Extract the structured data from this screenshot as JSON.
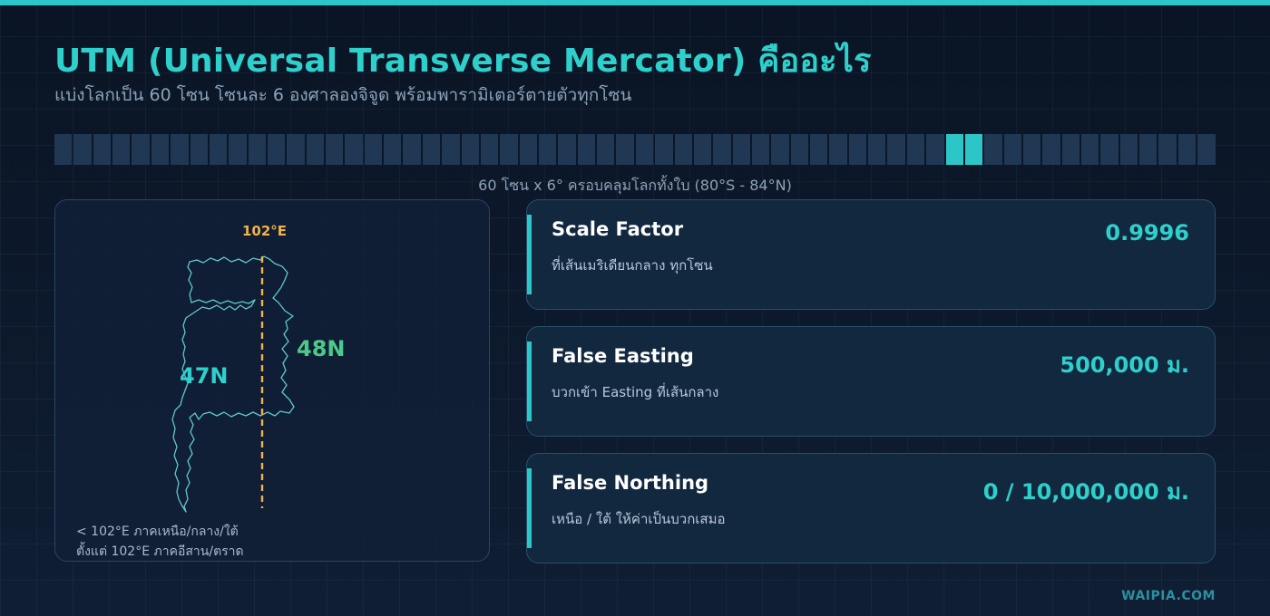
{
  "header": {
    "title": "UTM (Universal Transverse Mercator) คืออะไร",
    "subtitle": "แบ่งโลกเป็น 60 โซน โซนละ 6 องศาลองจิจูด พร้อมพารามิเตอร์ตายตัวทุกโซน"
  },
  "zone_strip": {
    "total_zones": 60,
    "highlighted_zones": [
      47,
      48
    ],
    "caption": "60 โซน x 6° ครอบคลุมโลกทั้งใบ (80°S - 84°N)",
    "colors": {
      "zone": "#203853",
      "highlight": "#2cc6c8"
    }
  },
  "map": {
    "meridian_label": "102°E",
    "zone_west": "47N",
    "zone_east": "48N",
    "legend": [
      "< 102°E ภาคเหนือ/กลาง/ใต้",
      "ตั้งแต่ 102°E ภาคอีสาน/ตราด"
    ],
    "colors": {
      "outline": "#5fc9c9",
      "meridian": "#f1b24a",
      "west": "#2ed0cc",
      "east": "#4cc98a"
    }
  },
  "cards": [
    {
      "title": "Scale Factor",
      "desc": "ที่เส้นเมริเดียนกลาง ทุกโซน",
      "value": "0.9996"
    },
    {
      "title": "False Easting",
      "desc": "บวกเข้า Easting ที่เส้นกลาง",
      "value": "500,000 ม."
    },
    {
      "title": "False Northing",
      "desc": "เหนือ / ใต้ ให้ค่าเป็นบวกเสมอ",
      "value": "0 / 10,000,000 ม."
    }
  ],
  "brand": "WAIPIA.COM",
  "colors": {
    "accent": "#2cc6c8",
    "background": "#0b1626",
    "card": "#12283f"
  }
}
